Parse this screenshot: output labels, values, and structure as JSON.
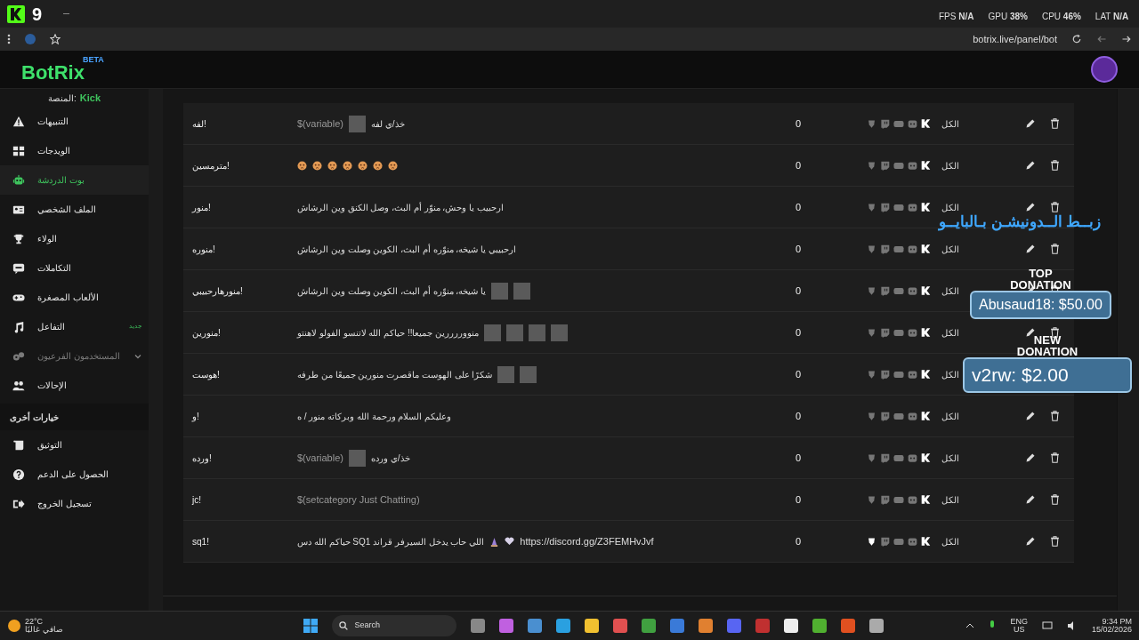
{
  "browser": {
    "app_logo": "9",
    "address": "botrix.live/panel/bot"
  },
  "perf_overlay": [
    "LAT **N/A**",
    "CPU **46%**",
    "GPU **38%**",
    "FPS **N/A**"
  ],
  "header": {
    "logo": "BotRix",
    "logo_badge": "BETA"
  },
  "sidebar": {
    "platform_label": "المنصة:",
    "platform": "Kick",
    "items": [
      {
        "label": "التنبيهات",
        "selected": false,
        "disabled": false
      },
      {
        "label": "الويدجات",
        "selected": false,
        "disabled": false
      },
      {
        "label": "بوت الدردشة",
        "selected": true,
        "disabled": false
      },
      {
        "label": "الملف الشخصي",
        "selected": false,
        "disabled": false
      },
      {
        "label": "الولاء",
        "selected": false,
        "disabled": false
      },
      {
        "label": "التكاملات",
        "selected": false,
        "disabled": false
      },
      {
        "label": "الألعاب المصغرة",
        "selected": false,
        "disabled": false
      },
      {
        "label": "التفاعل",
        "selected": false,
        "disabled": false,
        "badge": "جديد"
      },
      {
        "label": "المستخدمون الفرعيون",
        "selected": false,
        "disabled": true,
        "expandable": true
      },
      {
        "label": "الإحالات",
        "selected": false,
        "disabled": false
      }
    ],
    "section_title": "خيارات أخرى",
    "other_items": [
      {
        "label": "التوثيق"
      },
      {
        "label": "الحصول على الدعم"
      },
      {
        "label": "تسجيل الخروج"
      }
    ]
  },
  "commands": [
    {
      "name": "!لفه",
      "response": [
        {
          "kind": "text",
          "text": "خذ/ي لفه"
        },
        {
          "kind": "image"
        },
        {
          "kind": "variable",
          "text": "$(variable)"
        }
      ],
      "count": "0",
      "platform_on": [
        false,
        false,
        false,
        false,
        true
      ],
      "audience": "الكل"
    },
    {
      "name": "!مترمسين",
      "response": [
        {
          "kind": "emoji"
        },
        {
          "kind": "emoji"
        },
        {
          "kind": "emoji"
        },
        {
          "kind": "emoji"
        },
        {
          "kind": "emoji"
        },
        {
          "kind": "emoji"
        },
        {
          "kind": "emoji"
        }
      ],
      "count": "0",
      "platform_on": [
        false,
        false,
        false,
        false,
        true
      ],
      "audience": "الكل"
    },
    {
      "name": "!منور",
      "response": [
        {
          "kind": "text",
          "text": "ارحبيب يا وحش، منوّر أم البث، وصل الكنق وين الرشاش"
        }
      ],
      "count": "0",
      "platform_on": [
        false,
        false,
        false,
        false,
        true
      ],
      "audience": "الكل"
    },
    {
      "name": "!منوره",
      "response": [
        {
          "kind": "text",
          "text": "ارحبيبي يا شيخه، منوّره أم البث، الكوين وصلت وين الرشاش"
        }
      ],
      "count": "0",
      "platform_on": [
        false,
        false,
        false,
        false,
        true
      ],
      "audience": "الكل"
    },
    {
      "name": "!منورهارحبيبي",
      "response": [
        {
          "kind": "image"
        },
        {
          "kind": "image"
        },
        {
          "kind": "text",
          "text": "يا شيخه، منوّره أم البث، الكوين وصلت وين الرشاش"
        }
      ],
      "count": "0",
      "platform_on": [
        false,
        false,
        false,
        false,
        true
      ],
      "audience": "الكل"
    },
    {
      "name": "!منورين",
      "response": [
        {
          "kind": "image"
        },
        {
          "kind": "image"
        },
        {
          "kind": "image"
        },
        {
          "kind": "image"
        },
        {
          "kind": "text",
          "text": "منووررررين جميعا!! حياكم الله لاتنسو الفولو لاهنتو"
        }
      ],
      "count": "0",
      "platform_on": [
        false,
        false,
        false,
        false,
        true
      ],
      "audience": "الكل"
    },
    {
      "name": "!هوست",
      "response": [
        {
          "kind": "image"
        },
        {
          "kind": "image"
        },
        {
          "kind": "text",
          "text": "شكرًا على الهوست ماقصرت منورين جميعًا من طرفه"
        }
      ],
      "count": "0",
      "platform_on": [
        false,
        false,
        false,
        false,
        true
      ],
      "audience": "الكل"
    },
    {
      "name": "!و",
      "response": [
        {
          "kind": "text",
          "text": "وعليكم السلام ورحمة الله وبركاته منور / ه"
        }
      ],
      "count": "0",
      "platform_on": [
        false,
        false,
        false,
        false,
        true
      ],
      "audience": "الكل"
    },
    {
      "name": "!ورده",
      "response": [
        {
          "kind": "text",
          "text": "خذ/ي ورده"
        },
        {
          "kind": "image"
        },
        {
          "kind": "variable",
          "text": "$(variable)"
        }
      ],
      "count": "0",
      "platform_on": [
        false,
        false,
        false,
        false,
        true
      ],
      "audience": "الكل"
    },
    {
      "name": "!jc",
      "response": [
        {
          "kind": "variable",
          "text": "$(setcategory Just Chatting)"
        }
      ],
      "count": "0",
      "platform_on": [
        false,
        false,
        false,
        false,
        true
      ],
      "audience": "الكل"
    },
    {
      "name": "!sq1",
      "response": [
        {
          "kind": "link",
          "text": "https://discord.gg/Z3FEMHvJvf"
        },
        {
          "kind": "heart"
        },
        {
          "kind": "pray"
        },
        {
          "kind": "text",
          "text": "اللي حاب يدخل السيرفر قراند SQ1 حياكم الله دس"
        }
      ],
      "count": "0",
      "platform_on": [
        true,
        false,
        false,
        false,
        true
      ],
      "audience": "الكل"
    }
  ],
  "stream_overlay": {
    "banner": "زبــط الــدونيشـن بـالبايــو",
    "top_title": [
      "TOP",
      "DONATION"
    ],
    "top_value": "Abusaud18: $50.00",
    "new_title": [
      "NEW",
      "DONATION"
    ],
    "new_value": "v2rw: $2.00"
  },
  "taskbar": {
    "temperature": "22°C",
    "weather": "صافي غالبًا",
    "search": "Search",
    "language": "ENG",
    "region": "US",
    "time": "9:34 PM",
    "date": "15/02/2026"
  }
}
